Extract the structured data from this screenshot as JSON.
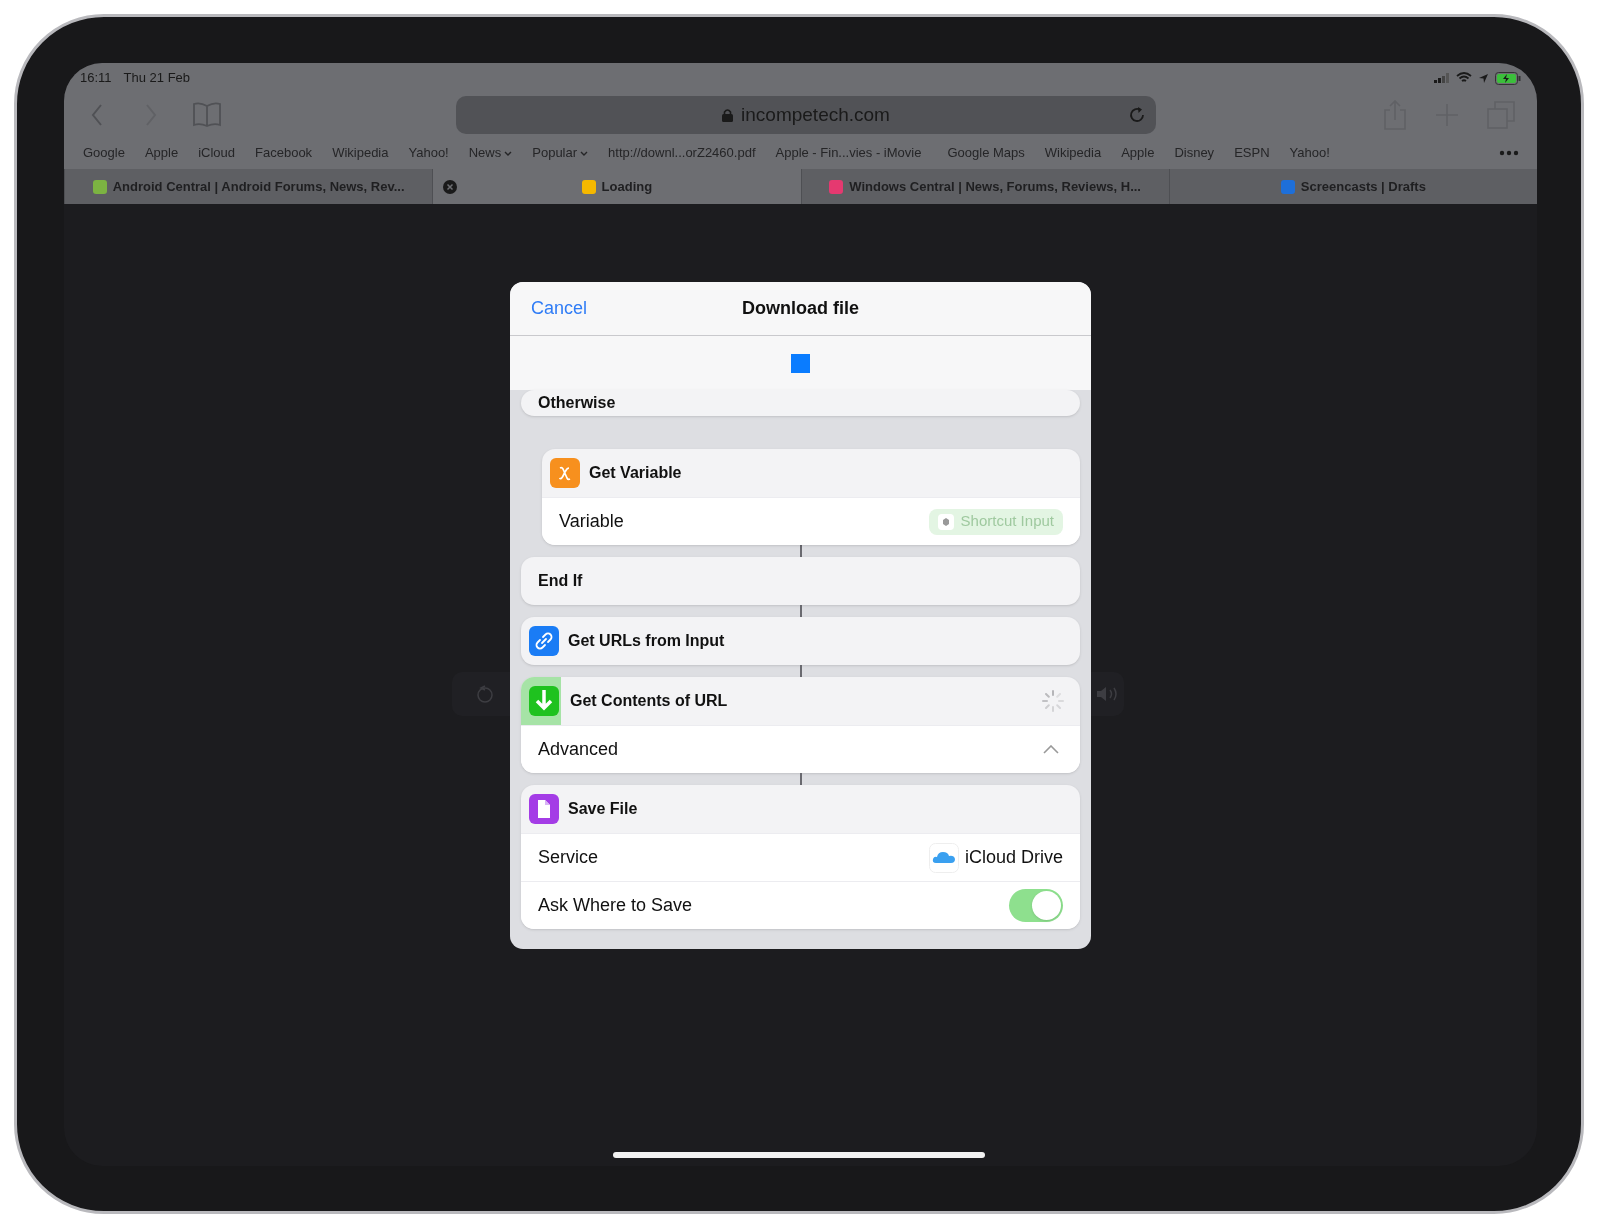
{
  "status_bar": {
    "time": "16:11",
    "date": "Thu 21 Feb"
  },
  "browser": {
    "address": "incompetech.com",
    "bookmarks": [
      {
        "label": "Google",
        "menu": false
      },
      {
        "label": "Apple",
        "menu": false
      },
      {
        "label": "iCloud",
        "menu": false
      },
      {
        "label": "Facebook",
        "menu": false
      },
      {
        "label": "Wikipedia",
        "menu": false
      },
      {
        "label": "Yahoo!",
        "menu": false
      },
      {
        "label": "News",
        "menu": true
      },
      {
        "label": "Popular",
        "menu": true
      },
      {
        "label": "http://downl...orZ2460.pdf",
        "menu": false
      },
      {
        "label": "Apple - Fin...vies - iMovie",
        "menu": false
      },
      {
        "label": "Google Maps",
        "menu": false
      },
      {
        "label": "Wikipedia",
        "menu": false
      },
      {
        "label": "Apple",
        "menu": false
      },
      {
        "label": "Disney",
        "menu": false
      },
      {
        "label": "ESPN",
        "menu": false
      },
      {
        "label": "Yahoo!",
        "menu": false
      }
    ],
    "tabs": [
      {
        "title": "Android Central | Android Forums, News, Rev...",
        "selected": false,
        "color": "#7cb342"
      },
      {
        "title": "Loading",
        "selected": true,
        "color": "#f5b800"
      },
      {
        "title": "Windows Central | News, Forums, Reviews, H...",
        "selected": false,
        "color": "#e53970"
      },
      {
        "title": "Screencasts | Drafts",
        "selected": false,
        "color": "#1e6fd9"
      }
    ]
  },
  "sheet": {
    "cancel": "Cancel",
    "title": "Download file",
    "actions": [
      {
        "kind": "block",
        "title": "Otherwise",
        "children": [
          {
            "kind": "variable",
            "title": "Get Variable",
            "running": false,
            "params": [
              {
                "kind": "token",
                "label": "Variable",
                "value": "Shortcut Input"
              }
            ]
          }
        ]
      },
      {
        "kind": "block",
        "title": "End If"
      },
      {
        "kind": "link",
        "title": "Get URLs from Input",
        "running": false
      },
      {
        "kind": "download",
        "title": "Get Contents of URL",
        "running": true,
        "params": [
          {
            "kind": "disclosure",
            "label": "Advanced",
            "expanded": true
          }
        ]
      },
      {
        "kind": "file",
        "title": "Save File",
        "running": false,
        "params": [
          {
            "kind": "service",
            "label": "Service",
            "value": "iCloud Drive"
          },
          {
            "kind": "toggle",
            "label": "Ask Where to Save",
            "on": true
          }
        ]
      }
    ]
  }
}
